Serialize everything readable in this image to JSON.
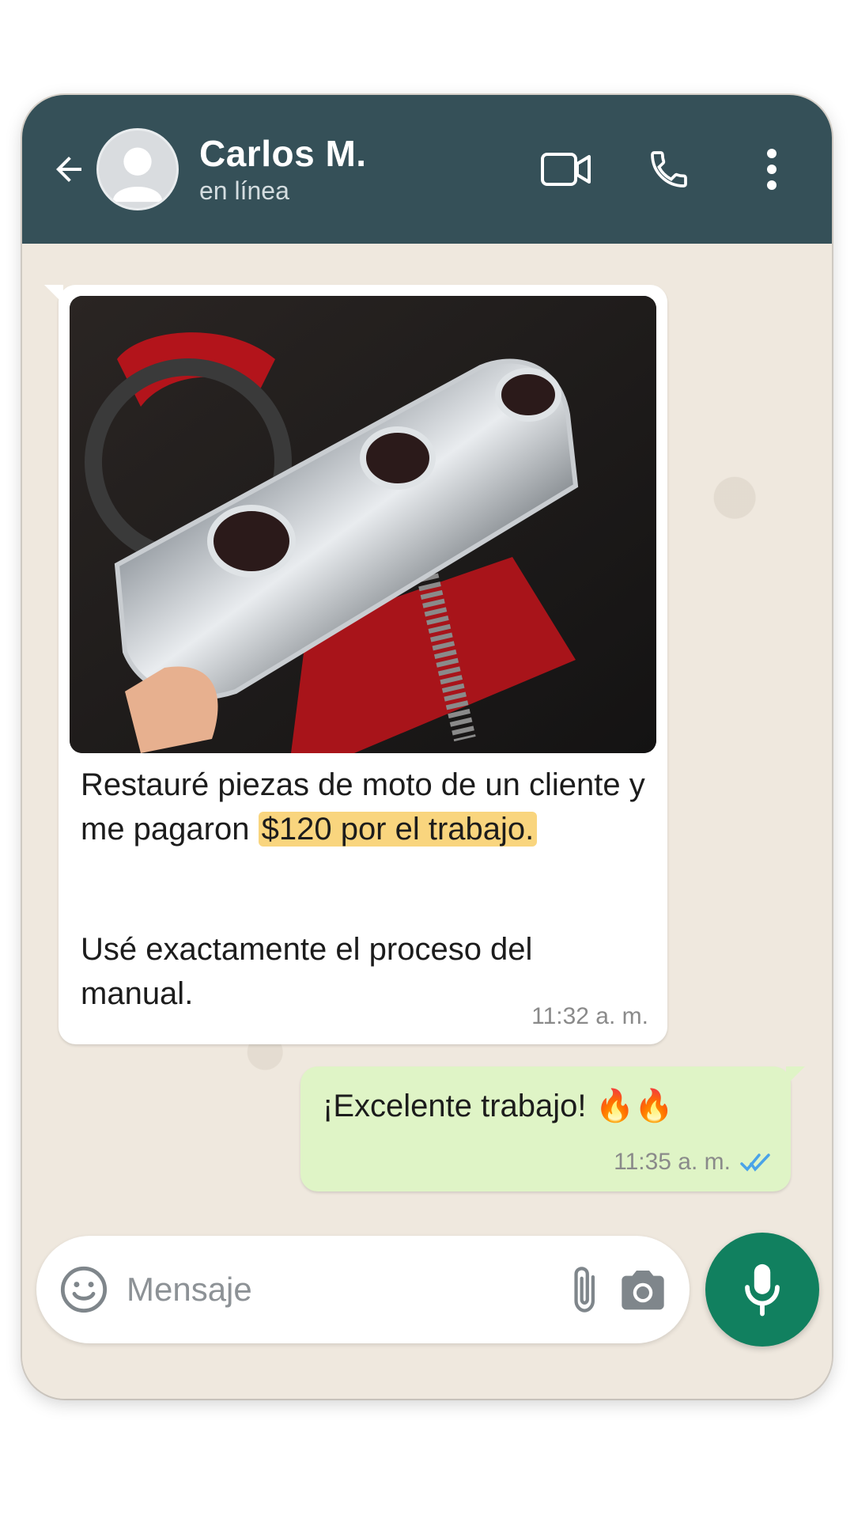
{
  "header": {
    "contact_name": "Carlos M.",
    "status": "en línea",
    "icons": [
      "back-arrow-icon",
      "video-call-icon",
      "phone-icon",
      "more-vert-icon"
    ],
    "bg_color": "#355058"
  },
  "messages": {
    "incoming": {
      "image_alt_subject": "chrome-motorcycle-part-photo",
      "paragraph1_before": "Restauré piezas de moto de un cliente y me pagaron ",
      "paragraph1_highlight": "$120 por el trabajo.",
      "paragraph2": "Usé exactamente el proceso del manual.",
      "time": "11:32 a. m."
    },
    "outgoing": {
      "text": "¡Excelente trabajo! 🔥🔥",
      "time": "11:35 a. m.",
      "status_icon": "double-check-icon",
      "bubble_color": "#dff4c6"
    }
  },
  "composer": {
    "placeholder": "Mensaje",
    "icons": [
      "emoji-icon",
      "attach-icon",
      "camera-icon",
      "mic-icon"
    ],
    "mic_color": "#11805f"
  }
}
